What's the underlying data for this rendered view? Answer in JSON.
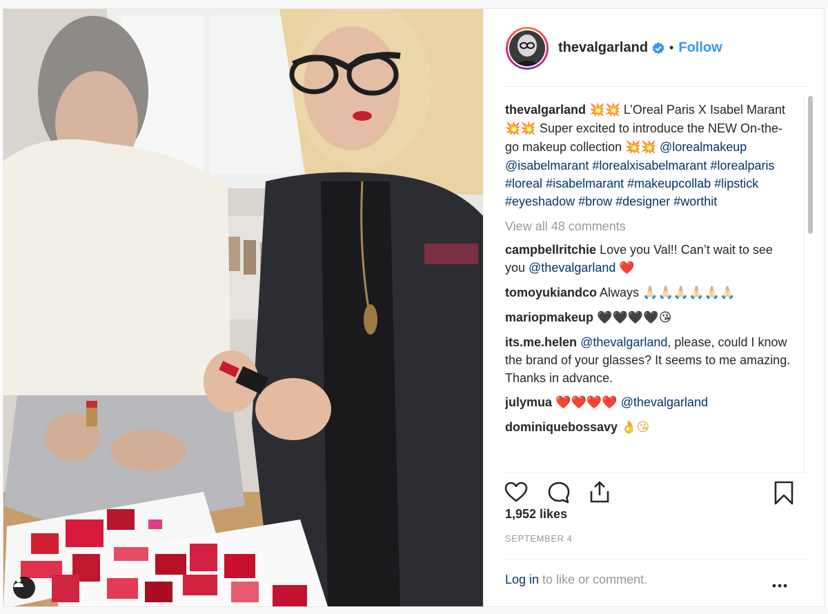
{
  "header": {
    "username": "thevalgarland",
    "separator": "•",
    "follow_label": "Follow"
  },
  "caption": {
    "username": "thevalgarland",
    "emoji_a": "💥💥",
    "text_a": " L’Oreal Paris X Isabel Marant ",
    "emoji_b": "💥💥",
    "text_b": " Super excited to introduce the NEW On-the-go makeup collection ",
    "emoji_c": "💥💥",
    "mentions": [
      "@lorealmakeup",
      "@isabelmarant"
    ],
    "hashtags": [
      "#lorealxisabelmarant",
      "#lorealparis",
      "#loreal",
      "#isabelmarant",
      "#makeupcollab",
      "#lipstick",
      "#eyeshadow",
      "#brow",
      "#designer",
      "#worthit"
    ]
  },
  "view_all_comments": "View all 48 comments",
  "comments": [
    {
      "username": "campbellritchie",
      "text": "Love you Val!! Can’t wait to see you ",
      "mention": "@thevalgarland",
      "emoji": "❤️"
    },
    {
      "username": "tomoyukiandco",
      "text": "Always ",
      "emoji": "🙏🏻🙏🏻🙏🏻🙏🏻🙏🏻🙏🏻"
    },
    {
      "username": "mariopmakeup",
      "text": "",
      "emoji": "🖤🖤🖤🖤😘"
    },
    {
      "username": "its.me.helen",
      "mention": "@thevalgarland",
      "text": ", please, could I know the brand of your glasses? It seems to me amazing. Thanks in advance."
    },
    {
      "username": "julymua",
      "emoji": "❤️❤️❤️❤️",
      "mention": "@thevalgarland"
    },
    {
      "username": "dominiquebossavy",
      "emoji": "👌😘"
    }
  ],
  "icons": {
    "like": "heart-icon",
    "comment": "comment-bubble-icon",
    "share": "share-icon",
    "save": "bookmark-icon",
    "more": "more-dots-icon",
    "tag": "user-tag-icon",
    "verified": "verified-badge-icon"
  },
  "likes": "1,952 likes",
  "date": "SEPTEMBER 4",
  "login": {
    "link": "Log in",
    "rest": " to like or comment."
  },
  "colors": {
    "link": "#003569",
    "follow": "#3897f0",
    "muted": "#999999",
    "verified": "#3897f0"
  }
}
